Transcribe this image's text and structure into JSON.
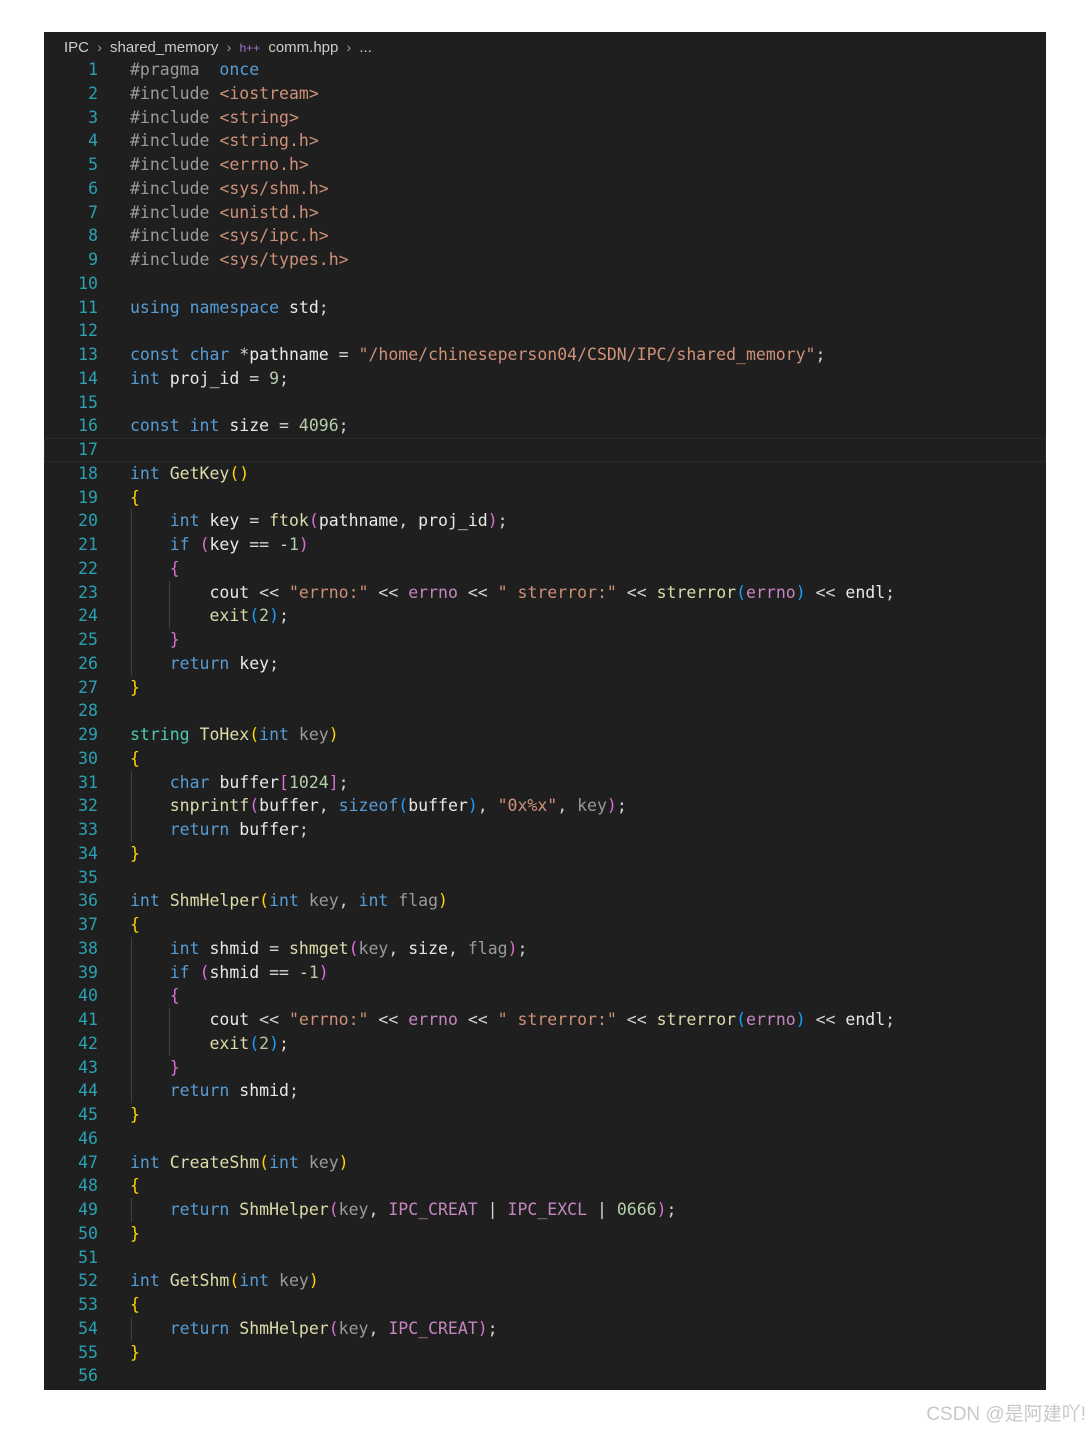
{
  "breadcrumb": {
    "items": [
      "IPC",
      "shared_memory",
      "comm.hpp",
      "..."
    ],
    "file_icon": "h++"
  },
  "editor": {
    "current_line": 17,
    "lines": [
      [
        [
          "pp",
          "#pragma"
        ],
        [
          "",
          "  "
        ],
        [
          "kw",
          "once"
        ]
      ],
      [
        [
          "pp",
          "#include"
        ],
        [
          "",
          " "
        ],
        [
          "inc",
          "<iostream>"
        ]
      ],
      [
        [
          "pp",
          "#include"
        ],
        [
          "",
          " "
        ],
        [
          "inc",
          "<string>"
        ]
      ],
      [
        [
          "pp",
          "#include"
        ],
        [
          "",
          " "
        ],
        [
          "inc",
          "<string.h>"
        ]
      ],
      [
        [
          "pp",
          "#include"
        ],
        [
          "",
          " "
        ],
        [
          "inc",
          "<errno.h>"
        ]
      ],
      [
        [
          "pp",
          "#include"
        ],
        [
          "",
          " "
        ],
        [
          "inc",
          "<sys/shm.h>"
        ]
      ],
      [
        [
          "pp",
          "#include"
        ],
        [
          "",
          " "
        ],
        [
          "inc",
          "<unistd.h>"
        ]
      ],
      [
        [
          "pp",
          "#include"
        ],
        [
          "",
          " "
        ],
        [
          "inc",
          "<sys/ipc.h>"
        ]
      ],
      [
        [
          "pp",
          "#include"
        ],
        [
          "",
          " "
        ],
        [
          "inc",
          "<sys/types.h>"
        ]
      ],
      [],
      [
        [
          "kw",
          "using"
        ],
        [
          "",
          " "
        ],
        [
          "kw",
          "namespace"
        ],
        [
          "",
          " "
        ],
        [
          "ns",
          "std"
        ],
        [
          "",
          ";"
        ]
      ],
      [],
      [
        [
          "kw",
          "const"
        ],
        [
          "",
          " "
        ],
        [
          "kw",
          "char"
        ],
        [
          "",
          " *"
        ],
        [
          "var",
          "pathname"
        ],
        [
          "",
          " = "
        ],
        [
          "str",
          "\"/home/chineseperson04/CSDN/IPC/shared_memory\""
        ],
        [
          "",
          ";"
        ]
      ],
      [
        [
          "kw",
          "int"
        ],
        [
          "",
          " "
        ],
        [
          "var",
          "proj_id"
        ],
        [
          "",
          " = "
        ],
        [
          "num",
          "9"
        ],
        [
          "",
          ";"
        ]
      ],
      [],
      [
        [
          "kw",
          "const"
        ],
        [
          "",
          " "
        ],
        [
          "kw",
          "int"
        ],
        [
          "",
          " "
        ],
        [
          "var",
          "size"
        ],
        [
          "",
          " = "
        ],
        [
          "num",
          "4096"
        ],
        [
          "",
          ";"
        ]
      ],
      [],
      [
        [
          "kw",
          "int"
        ],
        [
          "",
          " "
        ],
        [
          "fn",
          "GetKey"
        ],
        [
          "b1",
          "()"
        ]
      ],
      [
        [
          "b1",
          "{"
        ]
      ],
      [
        [
          "",
          "    "
        ],
        [
          "kw",
          "int"
        ],
        [
          "",
          " "
        ],
        [
          "var",
          "key"
        ],
        [
          "",
          " = "
        ],
        [
          "fn",
          "ftok"
        ],
        [
          "b2",
          "("
        ],
        [
          "var",
          "pathname"
        ],
        [
          "",
          ", "
        ],
        [
          "var",
          "proj_id"
        ],
        [
          "b2",
          ")"
        ],
        [
          "",
          ";"
        ]
      ],
      [
        [
          "",
          "    "
        ],
        [
          "ctl",
          "if"
        ],
        [
          "",
          " "
        ],
        [
          "b2",
          "("
        ],
        [
          "var",
          "key"
        ],
        [
          "",
          " == -"
        ],
        [
          "num",
          "1"
        ],
        [
          "b2",
          ")"
        ]
      ],
      [
        [
          "",
          "    "
        ],
        [
          "b2",
          "{"
        ]
      ],
      [
        [
          "",
          "        "
        ],
        [
          "var",
          "cout"
        ],
        [
          "",
          " << "
        ],
        [
          "str",
          "\"errno:\""
        ],
        [
          "",
          " << "
        ],
        [
          "mac",
          "errno"
        ],
        [
          "",
          " << "
        ],
        [
          "str",
          "\" strerror:\""
        ],
        [
          "",
          " << "
        ],
        [
          "fn",
          "strerror"
        ],
        [
          "b3",
          "("
        ],
        [
          "mac",
          "errno"
        ],
        [
          "b3",
          ")"
        ],
        [
          "",
          " << "
        ],
        [
          "var",
          "endl"
        ],
        [
          "",
          ";"
        ]
      ],
      [
        [
          "",
          "        "
        ],
        [
          "fn",
          "exit"
        ],
        [
          "b3",
          "("
        ],
        [
          "num",
          "2"
        ],
        [
          "b3",
          ")"
        ],
        [
          "",
          ";"
        ]
      ],
      [
        [
          "",
          "    "
        ],
        [
          "b2",
          "}"
        ]
      ],
      [
        [
          "",
          "    "
        ],
        [
          "ctl",
          "return"
        ],
        [
          "",
          " "
        ],
        [
          "var",
          "key"
        ],
        [
          "",
          ";"
        ]
      ],
      [
        [
          "b1",
          "}"
        ]
      ],
      [],
      [
        [
          "typ",
          "string"
        ],
        [
          "",
          " "
        ],
        [
          "fn",
          "ToHex"
        ],
        [
          "b1",
          "("
        ],
        [
          "kw",
          "int"
        ],
        [
          "",
          " "
        ],
        [
          "parm",
          "key"
        ],
        [
          "b1",
          ")"
        ]
      ],
      [
        [
          "b1",
          "{"
        ]
      ],
      [
        [
          "",
          "    "
        ],
        [
          "kw",
          "char"
        ],
        [
          "",
          " "
        ],
        [
          "var",
          "buffer"
        ],
        [
          "b2",
          "["
        ],
        [
          "num",
          "1024"
        ],
        [
          "b2",
          "]"
        ],
        [
          "",
          ";"
        ]
      ],
      [
        [
          "",
          "    "
        ],
        [
          "fn",
          "snprintf"
        ],
        [
          "b2",
          "("
        ],
        [
          "var",
          "buffer"
        ],
        [
          "",
          ", "
        ],
        [
          "kw",
          "sizeof"
        ],
        [
          "b3",
          "("
        ],
        [
          "var",
          "buffer"
        ],
        [
          "b3",
          ")"
        ],
        [
          "",
          ", "
        ],
        [
          "str",
          "\"0x%x\""
        ],
        [
          "",
          ", "
        ],
        [
          "parm",
          "key"
        ],
        [
          "b2",
          ")"
        ],
        [
          "",
          ";"
        ]
      ],
      [
        [
          "",
          "    "
        ],
        [
          "ctl",
          "return"
        ],
        [
          "",
          " "
        ],
        [
          "var",
          "buffer"
        ],
        [
          "",
          ";"
        ]
      ],
      [
        [
          "b1",
          "}"
        ]
      ],
      [],
      [
        [
          "kw",
          "int"
        ],
        [
          "",
          " "
        ],
        [
          "fn",
          "ShmHelper"
        ],
        [
          "b1",
          "("
        ],
        [
          "kw",
          "int"
        ],
        [
          "",
          " "
        ],
        [
          "parm",
          "key"
        ],
        [
          "",
          ", "
        ],
        [
          "kw",
          "int"
        ],
        [
          "",
          " "
        ],
        [
          "parm",
          "flag"
        ],
        [
          "b1",
          ")"
        ]
      ],
      [
        [
          "b1",
          "{"
        ]
      ],
      [
        [
          "",
          "    "
        ],
        [
          "kw",
          "int"
        ],
        [
          "",
          " "
        ],
        [
          "var",
          "shmid"
        ],
        [
          "",
          " = "
        ],
        [
          "fn",
          "shmget"
        ],
        [
          "b2",
          "("
        ],
        [
          "parm",
          "key"
        ],
        [
          "",
          ", "
        ],
        [
          "var",
          "size"
        ],
        [
          "",
          ", "
        ],
        [
          "parm",
          "flag"
        ],
        [
          "b2",
          ")"
        ],
        [
          "",
          ";"
        ]
      ],
      [
        [
          "",
          "    "
        ],
        [
          "ctl",
          "if"
        ],
        [
          "",
          " "
        ],
        [
          "b2",
          "("
        ],
        [
          "var",
          "shmid"
        ],
        [
          "",
          " == -"
        ],
        [
          "num",
          "1"
        ],
        [
          "b2",
          ")"
        ]
      ],
      [
        [
          "",
          "    "
        ],
        [
          "b2",
          "{"
        ]
      ],
      [
        [
          "",
          "        "
        ],
        [
          "var",
          "cout"
        ],
        [
          "",
          " << "
        ],
        [
          "str",
          "\"errno:\""
        ],
        [
          "",
          " << "
        ],
        [
          "mac",
          "errno"
        ],
        [
          "",
          " << "
        ],
        [
          "str",
          "\" strerror:\""
        ],
        [
          "",
          " << "
        ],
        [
          "fn",
          "strerror"
        ],
        [
          "b3",
          "("
        ],
        [
          "mac",
          "errno"
        ],
        [
          "b3",
          ")"
        ],
        [
          "",
          " << "
        ],
        [
          "var",
          "endl"
        ],
        [
          "",
          ";"
        ]
      ],
      [
        [
          "",
          "        "
        ],
        [
          "fn",
          "exit"
        ],
        [
          "b3",
          "("
        ],
        [
          "num",
          "2"
        ],
        [
          "b3",
          ")"
        ],
        [
          "",
          ";"
        ]
      ],
      [
        [
          "",
          "    "
        ],
        [
          "b2",
          "}"
        ]
      ],
      [
        [
          "",
          "    "
        ],
        [
          "ctl",
          "return"
        ],
        [
          "",
          " "
        ],
        [
          "var",
          "shmid"
        ],
        [
          "",
          ";"
        ]
      ],
      [
        [
          "b1",
          "}"
        ]
      ],
      [],
      [
        [
          "kw",
          "int"
        ],
        [
          "",
          " "
        ],
        [
          "fn",
          "CreateShm"
        ],
        [
          "b1",
          "("
        ],
        [
          "kw",
          "int"
        ],
        [
          "",
          " "
        ],
        [
          "parm",
          "key"
        ],
        [
          "b1",
          ")"
        ]
      ],
      [
        [
          "b1",
          "{"
        ]
      ],
      [
        [
          "",
          "    "
        ],
        [
          "ctl",
          "return"
        ],
        [
          "",
          " "
        ],
        [
          "fn",
          "ShmHelper"
        ],
        [
          "b2",
          "("
        ],
        [
          "parm",
          "key"
        ],
        [
          "",
          ", "
        ],
        [
          "mac",
          "IPC_CREAT"
        ],
        [
          "",
          " | "
        ],
        [
          "mac",
          "IPC_EXCL"
        ],
        [
          "",
          " | "
        ],
        [
          "num",
          "0666"
        ],
        [
          "b2",
          ")"
        ],
        [
          "",
          ";"
        ]
      ],
      [
        [
          "b1",
          "}"
        ]
      ],
      [],
      [
        [
          "kw",
          "int"
        ],
        [
          "",
          " "
        ],
        [
          "fn",
          "GetShm"
        ],
        [
          "b1",
          "("
        ],
        [
          "kw",
          "int"
        ],
        [
          "",
          " "
        ],
        [
          "parm",
          "key"
        ],
        [
          "b1",
          ")"
        ]
      ],
      [
        [
          "b1",
          "{"
        ]
      ],
      [
        [
          "",
          "    "
        ],
        [
          "ctl",
          "return"
        ],
        [
          "",
          " "
        ],
        [
          "fn",
          "ShmHelper"
        ],
        [
          "b2",
          "("
        ],
        [
          "parm",
          "key"
        ],
        [
          "",
          ", "
        ],
        [
          "mac",
          "IPC_CREAT"
        ],
        [
          "b2",
          ")"
        ],
        [
          "",
          ";"
        ]
      ],
      [
        [
          "b1",
          "}"
        ]
      ],
      []
    ],
    "indent_guides": [
      {
        "col": 0,
        "from": 20,
        "to": 26
      },
      {
        "col": 1,
        "from": 23,
        "to": 24
      },
      {
        "col": 0,
        "from": 31,
        "to": 33
      },
      {
        "col": 0,
        "from": 38,
        "to": 44
      },
      {
        "col": 1,
        "from": 41,
        "to": 42
      },
      {
        "col": 0,
        "from": 49,
        "to": 49
      },
      {
        "col": 0,
        "from": 54,
        "to": 54
      }
    ]
  },
  "watermark": "CSDN @是阿建吖!"
}
